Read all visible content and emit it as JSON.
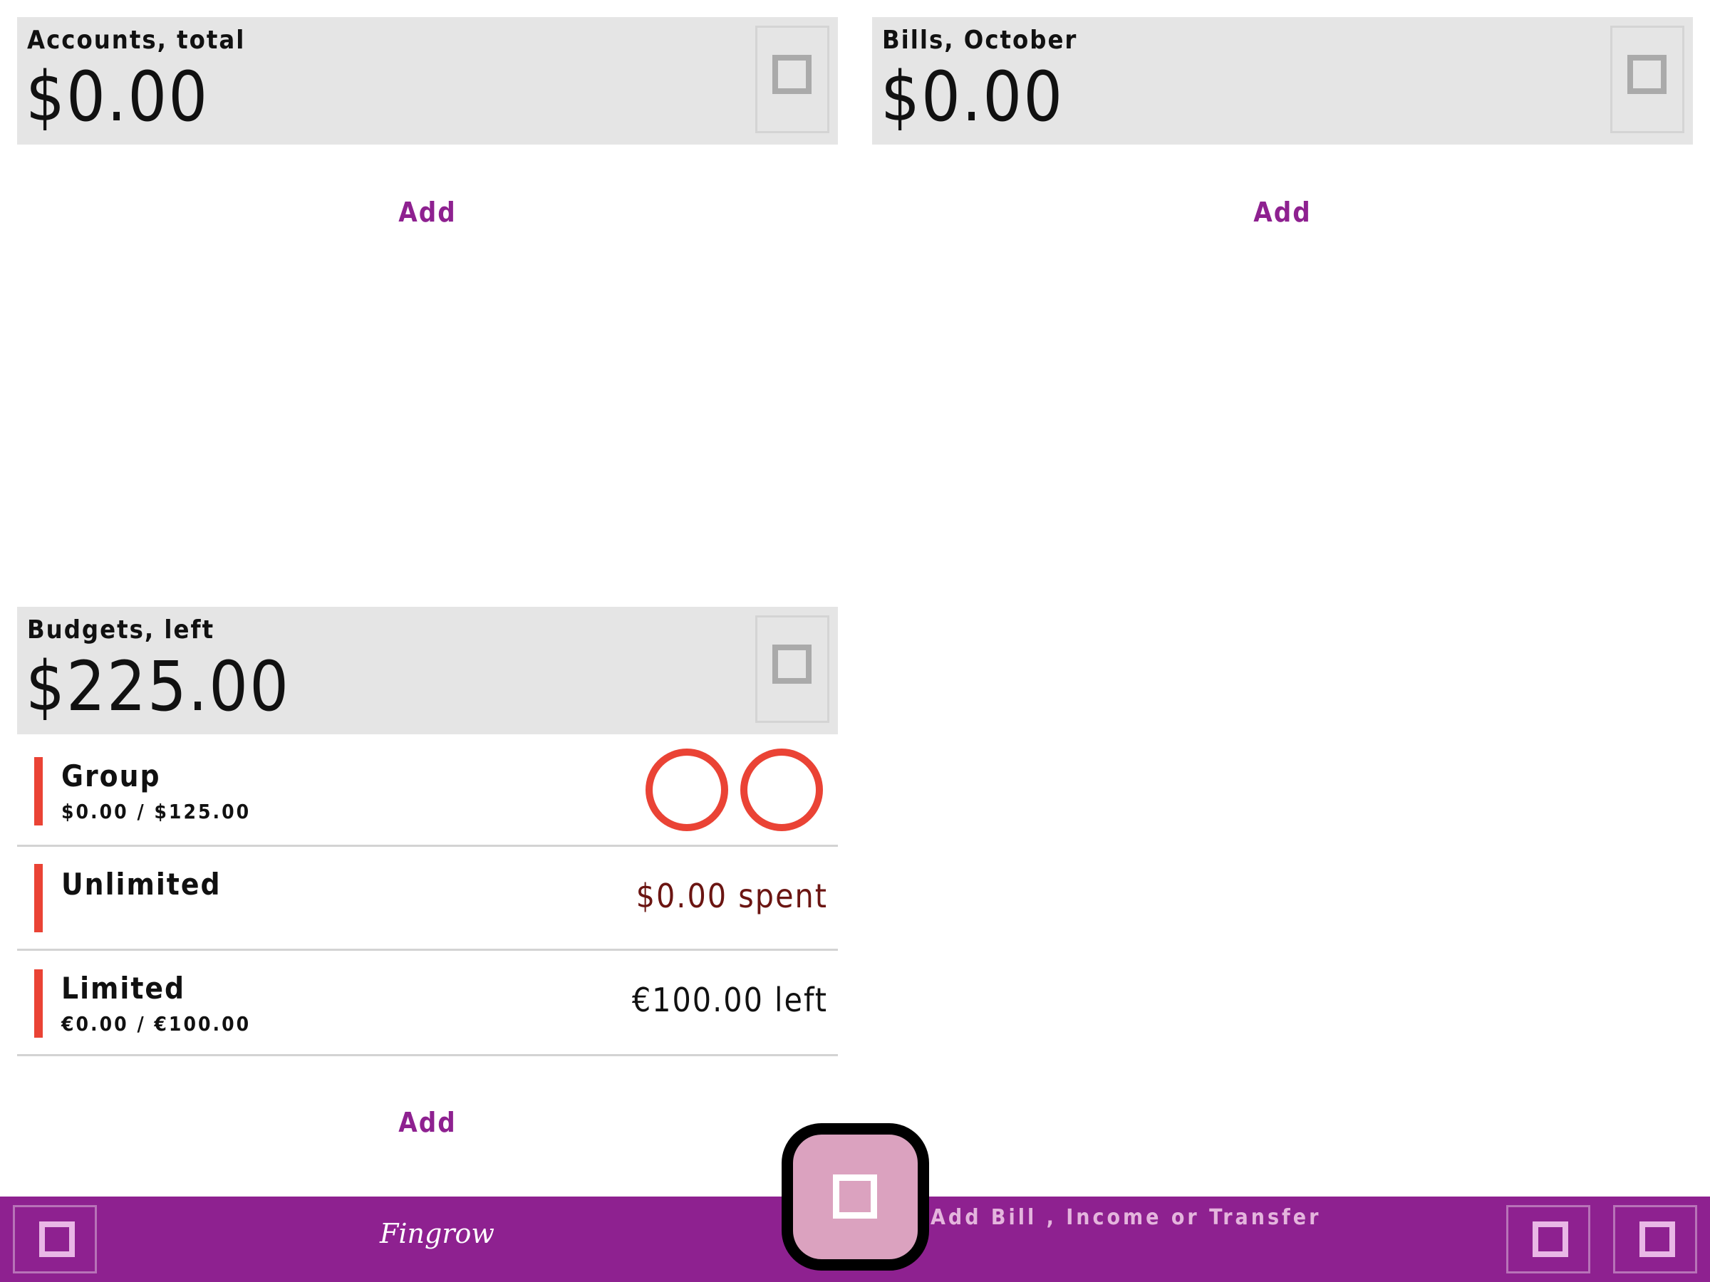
{
  "accounts": {
    "label": "Accounts, total",
    "amount": "$0.00",
    "add_label": "Add"
  },
  "bills": {
    "label": "Bills, October",
    "amount": "$0.00",
    "add_label": "Add"
  },
  "budgets": {
    "label": "Budgets, left",
    "amount": "$225.00",
    "add_label": "Add",
    "items": [
      {
        "name": "Group",
        "sub": "$0.00 / $125.00",
        "right": ""
      },
      {
        "name": "Unlimited",
        "sub": "",
        "right": "$0.00 spent"
      },
      {
        "name": "Limited",
        "sub": "€0.00 / €100.00",
        "right": "€100.00 left"
      }
    ]
  },
  "bottom_bar": {
    "logo": "Fingrow",
    "fab_label": "Add Bill , Income or Transfer"
  },
  "colors": {
    "accent": "#8e2190",
    "budget_bar": "#ea4335",
    "spent_text": "#6b1512",
    "fab_fill": "#dba2bf",
    "header_bg": "#e5e5e5"
  },
  "icons": {
    "card_menu": "square-icon",
    "fab": "square-icon",
    "nav_left": "square-icon",
    "nav_right_1": "square-icon",
    "nav_right_2": "square-icon"
  }
}
